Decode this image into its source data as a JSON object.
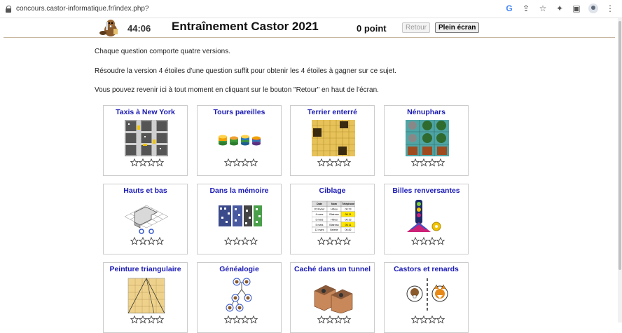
{
  "browser": {
    "url": "concours.castor-informatique.fr/index.php?",
    "icons": [
      "google-icon",
      "share-icon",
      "star-icon",
      "extension-icon",
      "sidepanel-icon",
      "profile-icon",
      "menu-icon"
    ]
  },
  "header": {
    "timer": "44:06",
    "title": "Entraînement Castor 2021",
    "score": "0 point",
    "retour_label": "Retour",
    "fullscreen_label": "Plein écran"
  },
  "intro": {
    "line1": "Chaque question comporte quatre versions.",
    "line2": "Résoudre la version 4 étoiles d'une question suffit pour obtenir les 4 étoiles à gagner sur ce sujet.",
    "line3": "Vous pouvez revenir ici à tout moment en cliquant sur le bouton \"Retour\" en haut de l'écran."
  },
  "colors": {
    "title_link": "#1a1ab5",
    "header_rule": "#c8b8a0"
  },
  "cards": [
    {
      "title": "Taxis à New York",
      "stars": 0,
      "icon": "city-grid-icon"
    },
    {
      "title": "Tours pareilles",
      "stars": 0,
      "icon": "token-stacks-icon"
    },
    {
      "title": "Terrier enterré",
      "stars": 0,
      "icon": "burrow-grid-icon"
    },
    {
      "title": "Nénuphars",
      "stars": 0,
      "icon": "lilypad-grid-icon"
    },
    {
      "title": "Hauts et bas",
      "stars": 0,
      "icon": "isometric-shape-icon"
    },
    {
      "title": "Dans la mémoire",
      "stars": 0,
      "icon": "memory-blocks-icon"
    },
    {
      "title": "Ciblage",
      "stars": 0,
      "icon": "table-icon",
      "table": {
        "headers": [
          "Date",
          "Nom",
          "Téléphone"
        ],
        "rows": [
          [
            "20 février",
            "Hibou",
            "06 23"
          ],
          [
            "4 mars",
            "Blaireau",
            "06 11"
          ],
          [
            "5 mars",
            "Hibou",
            "06 33"
          ],
          [
            "5 mars",
            "Blaireau",
            "06 11"
          ],
          [
            "12 mars",
            "Belette",
            "06 82"
          ]
        ]
      }
    },
    {
      "title": "Billes renversantes",
      "stars": 0,
      "icon": "marble-run-icon"
    },
    {
      "title": "Peinture triangulaire",
      "stars": 0,
      "icon": "triangle-paint-icon"
    },
    {
      "title": "Généalogie",
      "stars": 0,
      "icon": "family-tree-icon"
    },
    {
      "title": "Caché dans un tunnel",
      "stars": 0,
      "icon": "tunnel-boxes-icon"
    },
    {
      "title": "Castors et renards",
      "stars": 0,
      "icon": "beaver-fox-icon"
    }
  ]
}
